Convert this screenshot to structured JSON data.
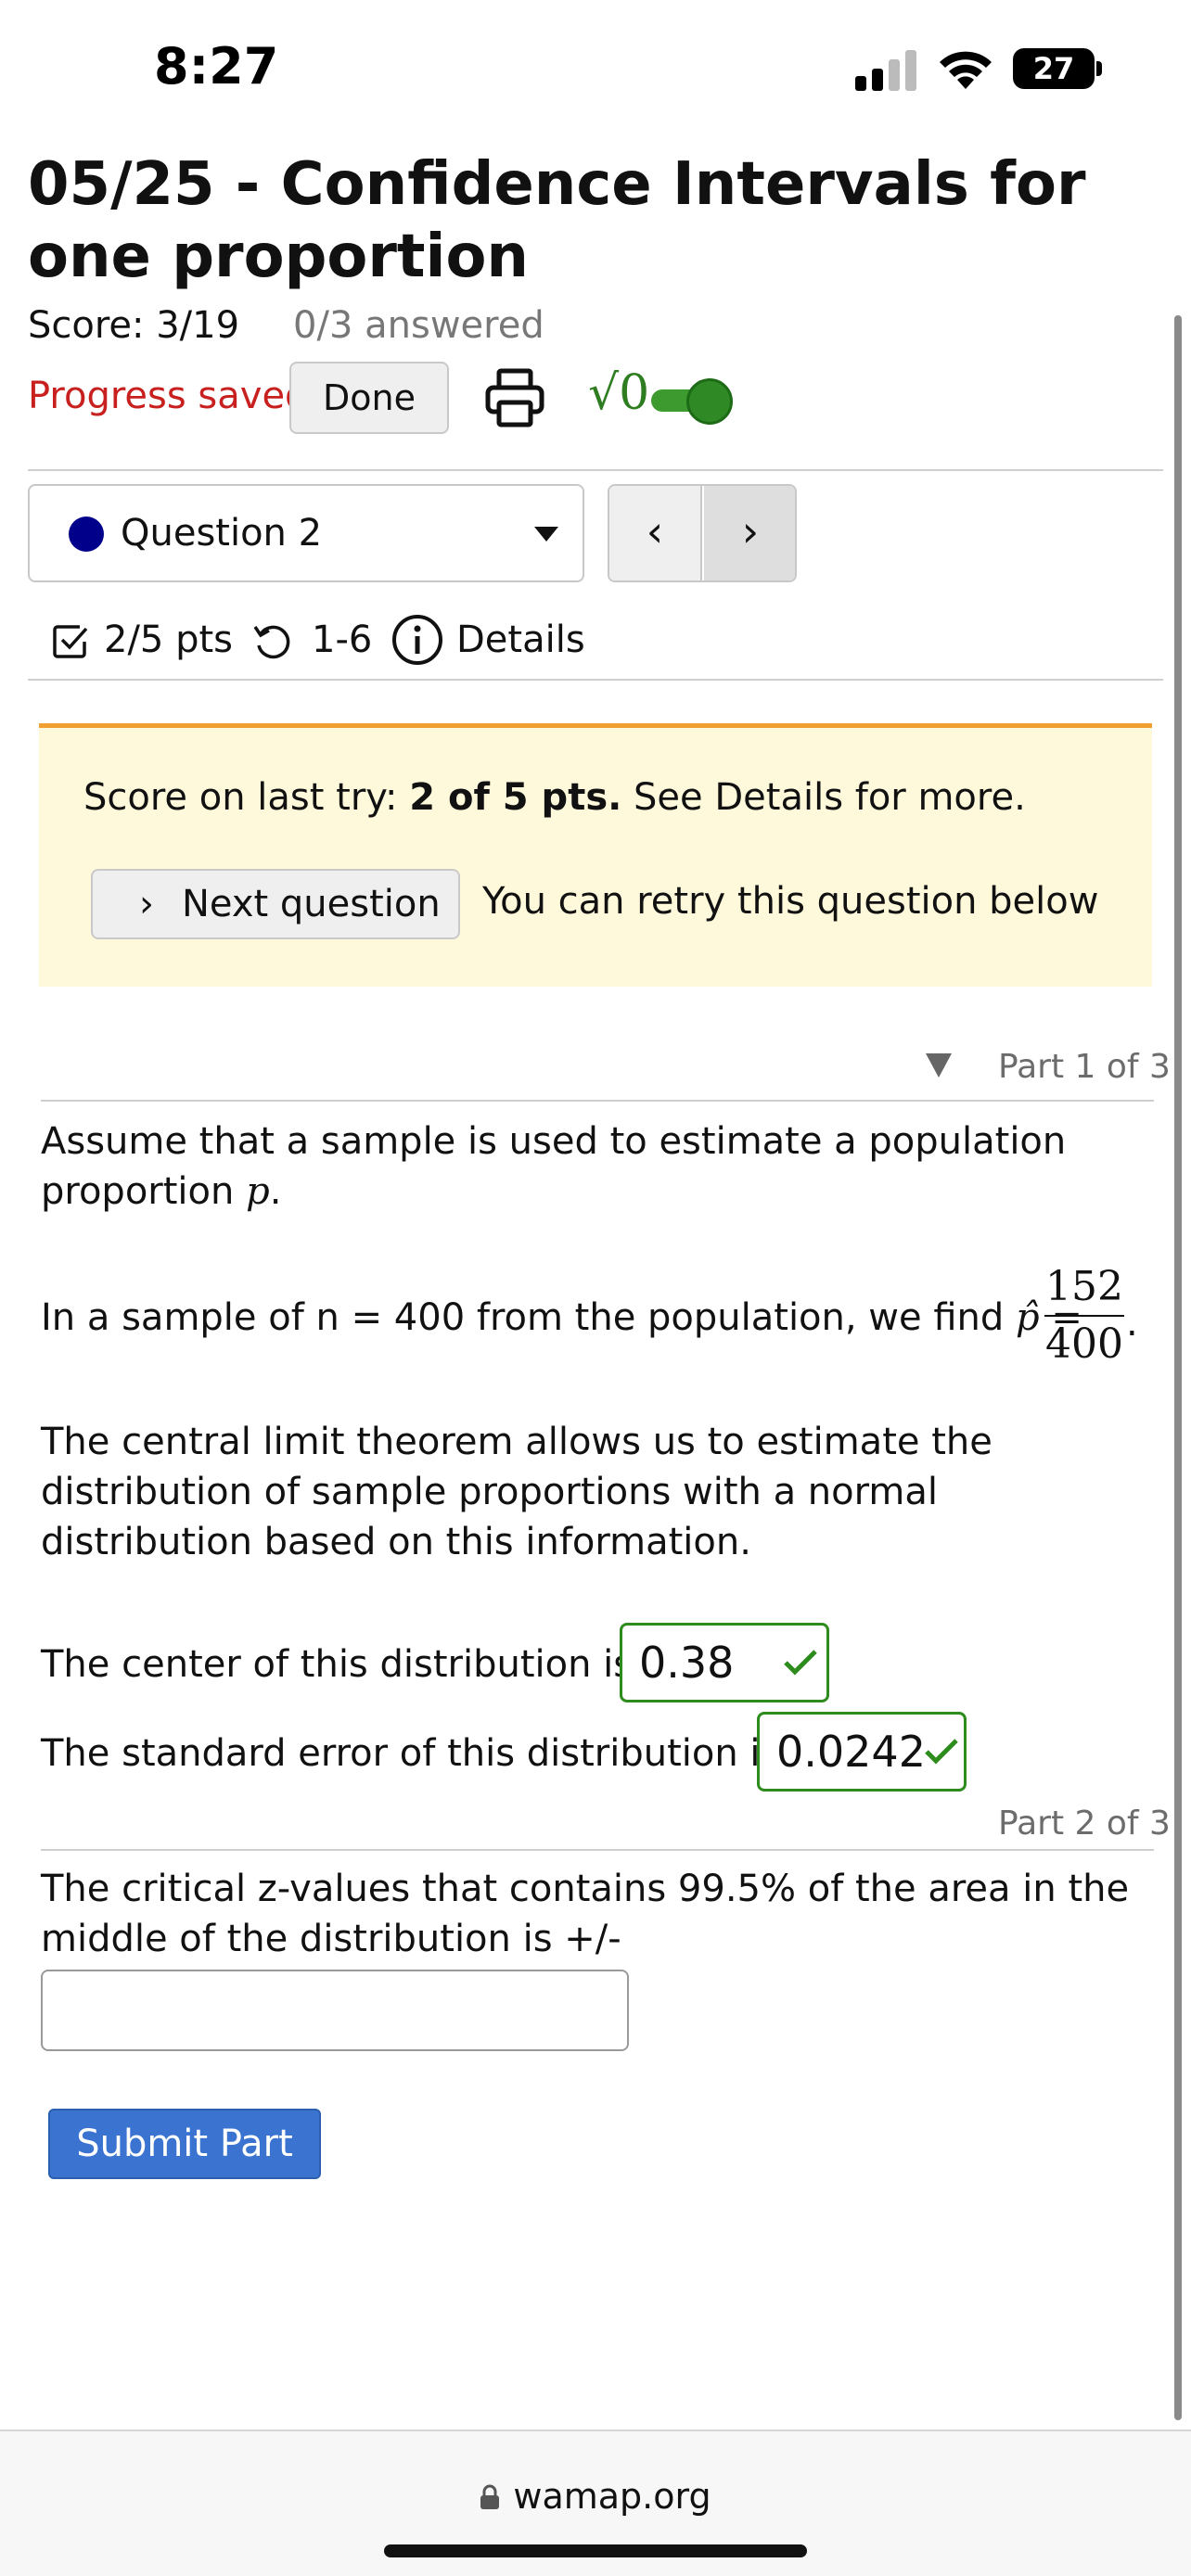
{
  "status_bar": {
    "time": "8:27",
    "battery": "27"
  },
  "header": {
    "title": "05/25 - Confidence Intervals for one proportion",
    "score": "Score: 3/19",
    "answered": "0/3 answered",
    "progress_saved": "Progress saved",
    "done_label": "Done",
    "math_toggle_label": "√0"
  },
  "question_nav": {
    "selected_question": "Question 2",
    "prev_label": "‹",
    "next_label": "›"
  },
  "meta": {
    "points": "2/5 pts",
    "attempts": "1-6",
    "details": "Details"
  },
  "notice": {
    "prefix": "Score on last try: ",
    "score": "2 of 5 pts.",
    "suffix": " See Details for more.",
    "next_question": "Next question",
    "retry_text": "You can retry this question below"
  },
  "part1": {
    "header": "Part 1 of 3",
    "assume_text": "Assume that a sample is used to estimate a population proportion ",
    "assume_var": "p",
    "assume_end": ".",
    "sample_text": "In a sample of n = 400 from the population, we find ",
    "phat": "p̂ =",
    "frac_num": "152",
    "frac_den": "400",
    "frac_end": ".",
    "clt_text": "The central limit theorem allows us to estimate the distribution of sample proportions with a normal distribution based on this information.",
    "center_label": "The center of this distribution is",
    "center_value": "0.38",
    "se_label": "The standard error of this distribution is",
    "se_value": "0.0242"
  },
  "part2": {
    "header": "Part 2 of 3",
    "question": "The critical z-values that contains 99.5% of the area in the middle of the distribution is +/-",
    "input_value": "",
    "submit_label": "Submit Part"
  },
  "browser": {
    "url": "wamap.org"
  },
  "colors": {
    "accent_blue": "#3a74d0",
    "correct_green": "#2e8b1e",
    "saved_red": "#c8201e",
    "notice_bg": "#fff9dc",
    "notice_border": "#f0a030"
  }
}
